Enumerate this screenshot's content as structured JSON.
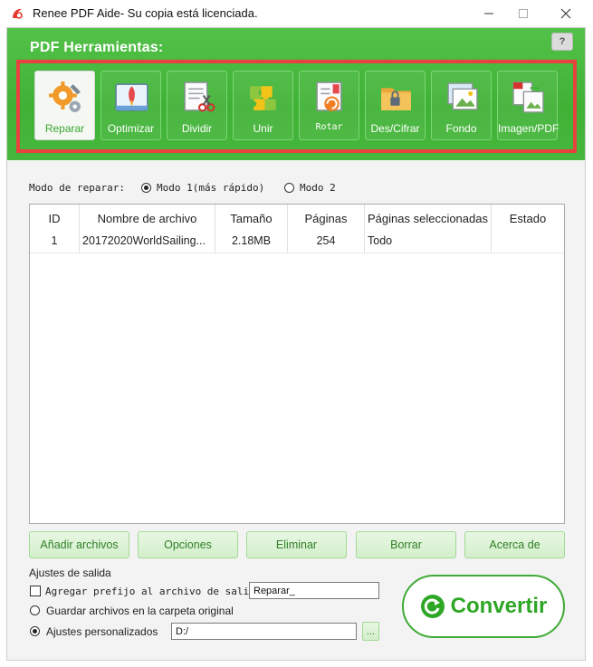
{
  "window": {
    "title": "Renee PDF Aide- Su copia está licenciada.",
    "minimize_icon": "minimize-icon",
    "maximize_icon": "maximize-icon",
    "close_icon": "close-icon"
  },
  "header": {
    "title": "PDF Herramientas:",
    "help_label": "?"
  },
  "tools": [
    {
      "label": "Reparar",
      "icon": "repair-gears-icon",
      "selected": true
    },
    {
      "label": "Optimizar",
      "icon": "rocket-icon"
    },
    {
      "label": "Dividir",
      "icon": "scissors-document-icon"
    },
    {
      "label": "Unir",
      "icon": "puzzle-icon"
    },
    {
      "label": "Rotar",
      "icon": "rotate-document-icon"
    },
    {
      "label": "Des/Cifrar",
      "icon": "folder-lock-icon"
    },
    {
      "label": "Fondo",
      "icon": "background-image-icon"
    },
    {
      "label": "Imagen/PDF",
      "icon": "image-to-pdf-icon"
    }
  ],
  "mode": {
    "label": "Modo de reparar:",
    "option1": "Modo 1(más rápido)",
    "option2": "Modo 2",
    "selected": 1
  },
  "table": {
    "columns": [
      "ID",
      "Nombre de archivo",
      "Tamaño",
      "Páginas",
      "Páginas seleccionadas",
      "Estado"
    ],
    "rows": [
      [
        "1",
        "20172020WorldSailing...",
        "2.18MB",
        "254",
        "Todo",
        ""
      ]
    ]
  },
  "buttons": {
    "add": "Añadir archivos",
    "options": "Opciones",
    "delete": "Eliminar",
    "clear": "Borrar",
    "about": "Acerca de"
  },
  "output": {
    "section_label": "Ajustes de salida",
    "prefix_label": "Agregar prefijo al archivo de salida",
    "prefix_value": "Reparar_",
    "prefix_checked": false,
    "save_original": "Guardar archivos en la carpeta original",
    "custom_label": "Ajustes personalizados",
    "custom_path": "D:/",
    "browse_label": "...",
    "selected": "custom"
  },
  "convert": {
    "label": "Convertir",
    "icon": "convert-arrow-icon"
  },
  "colors": {
    "brand_green": "#3fb236",
    "highlight_red": "#e8413f",
    "button_text": "#2f7f27"
  }
}
